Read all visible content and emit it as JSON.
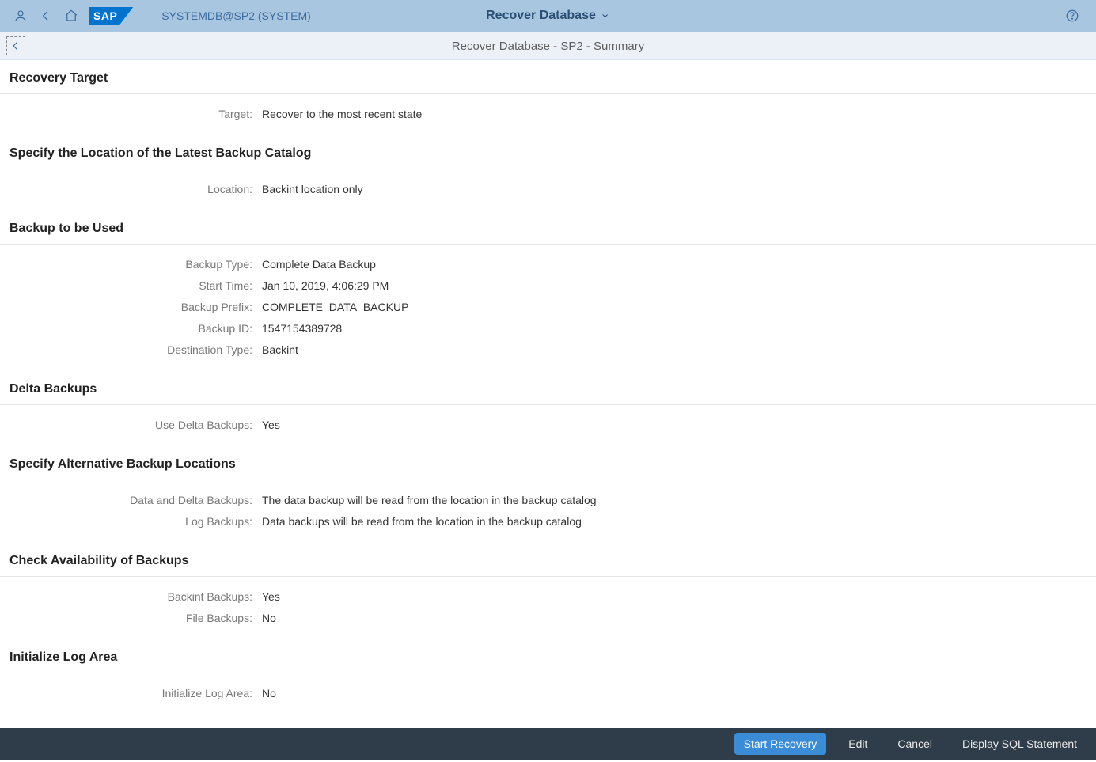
{
  "header": {
    "system_label": "SYSTEMDB@SP2 (SYSTEM)",
    "app_title": "Recover Database"
  },
  "subheader": {
    "title": "Recover Database - SP2 - Summary"
  },
  "sections": {
    "recovery_target": {
      "heading": "Recovery Target",
      "target_label": "Target:",
      "target_value": "Recover to the most recent state"
    },
    "backup_catalog": {
      "heading": "Specify the Location of the Latest Backup Catalog",
      "location_label": "Location:",
      "location_value": "Backint location only"
    },
    "backup_used": {
      "heading": "Backup to be Used",
      "type_label": "Backup Type:",
      "type_value": "Complete Data Backup",
      "start_label": "Start Time:",
      "start_value": "Jan 10, 2019, 4:06:29 PM",
      "prefix_label": "Backup Prefix:",
      "prefix_value": "COMPLETE_DATA_BACKUP",
      "id_label": "Backup ID:",
      "id_value": "1547154389728",
      "dest_label": "Destination Type:",
      "dest_value": "Backint"
    },
    "delta_backups": {
      "heading": "Delta Backups",
      "use_label": "Use Delta Backups:",
      "use_value": "Yes"
    },
    "alt_locations": {
      "heading": "Specify Alternative Backup Locations",
      "data_label": "Data and Delta Backups:",
      "data_value": "The data backup will be read from the location in the backup catalog",
      "log_label": "Log Backups:",
      "log_value": "Data backups will be read from the location in the backup catalog"
    },
    "check_avail": {
      "heading": "Check Availability of Backups",
      "backint_label": "Backint Backups:",
      "backint_value": "Yes",
      "file_label": "File Backups:",
      "file_value": "No"
    },
    "init_log": {
      "heading": "Initialize Log Area",
      "init_label": "Initialize Log Area:",
      "init_value": "No"
    }
  },
  "footer": {
    "start": "Start Recovery",
    "edit": "Edit",
    "cancel": "Cancel",
    "display_sql": "Display SQL Statement"
  }
}
